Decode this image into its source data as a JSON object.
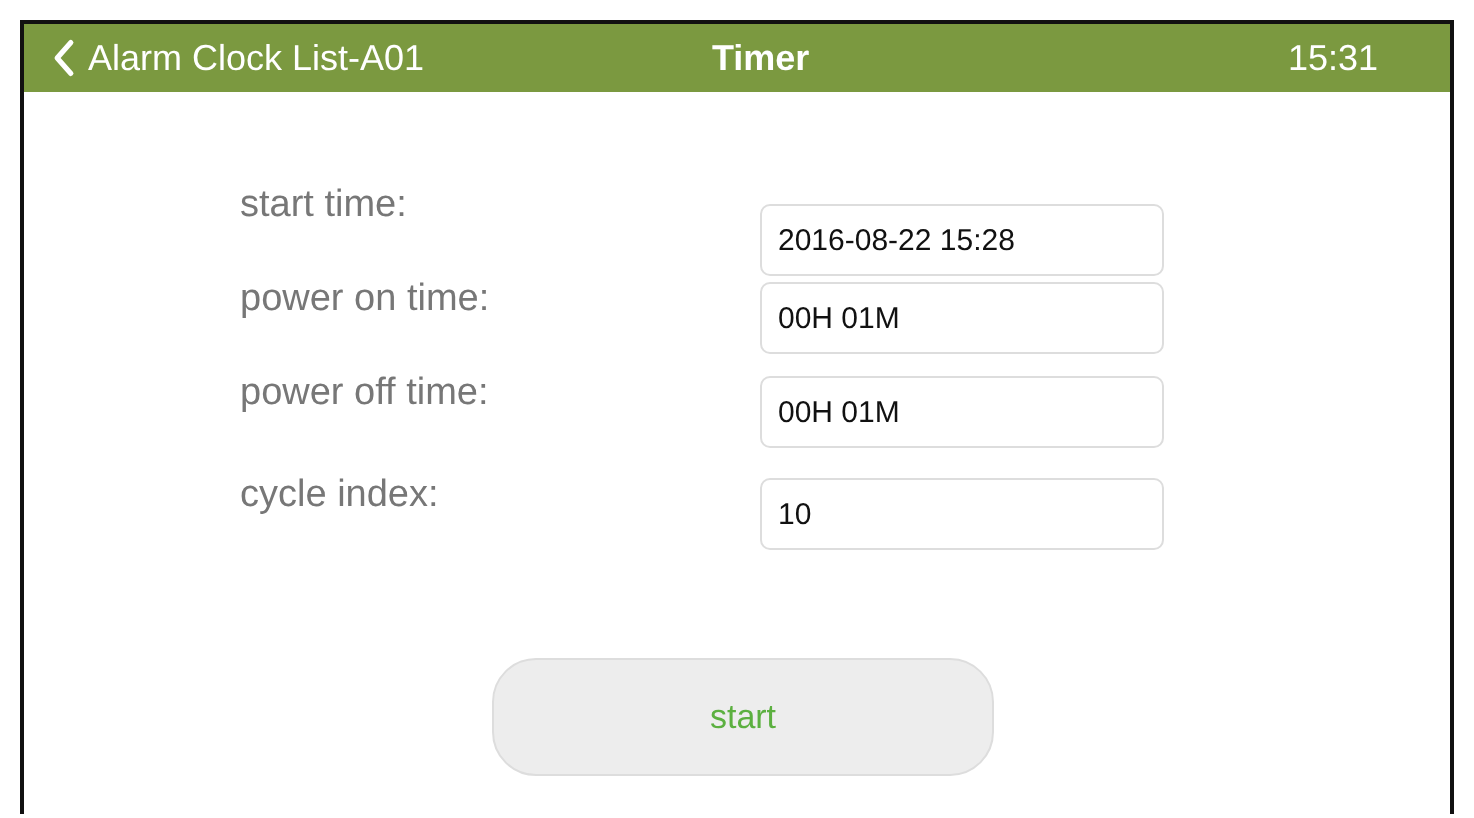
{
  "header": {
    "back_label": "Alarm Clock List-A01",
    "title": "Timer",
    "time": "15:31"
  },
  "fields": [
    {
      "label": "start time:",
      "value": "2016-08-22 15:28"
    },
    {
      "label": "power on time:",
      "value": "00H 01M"
    },
    {
      "label": "power off time:",
      "value": "00H 01M"
    },
    {
      "label": "cycle index:",
      "value": "10"
    }
  ],
  "start_button": {
    "label": "start"
  }
}
